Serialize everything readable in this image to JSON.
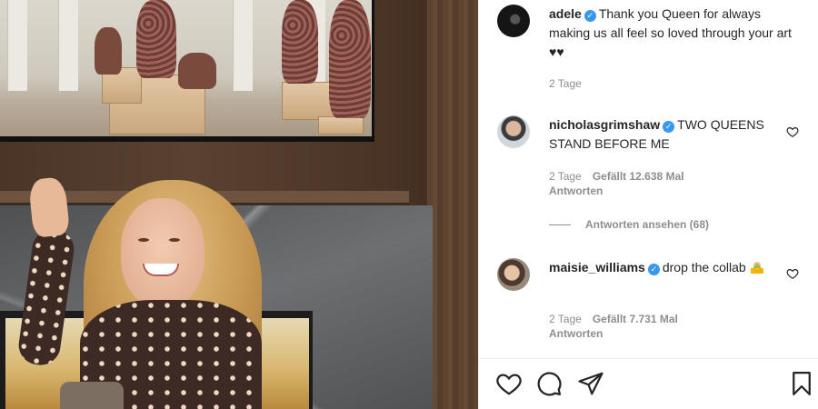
{
  "post": {
    "caption": {
      "username": "adele",
      "text": "Thank you Queen for always making us all feel so loved through your art ♥♥",
      "time": "2 Tage"
    },
    "comments": [
      {
        "username": "nicholasgrimshaw",
        "text": "TWO QUEENS STAND BEFORE ME",
        "time": "2 Tage",
        "likes": "Gefällt 12.638 Mal",
        "reply_label": "Antworten",
        "view_replies": "Antworten ansehen (68)"
      },
      {
        "username": "maisie_williams",
        "text": "drop the collab",
        "time": "2 Tage",
        "likes": "Gefällt 7.731 Mal",
        "reply_label": "Antworten"
      }
    ]
  },
  "icons": {
    "like": "heart-icon",
    "comment": "comment-icon",
    "share": "share-icon",
    "save": "bookmark-icon",
    "comment_like": "heart-icon",
    "verified": "verified-badge-icon",
    "emoji": "collab-emoji"
  },
  "colors": {
    "verified": "#3897f0",
    "text": "#262626",
    "muted": "#8e8e8e"
  }
}
